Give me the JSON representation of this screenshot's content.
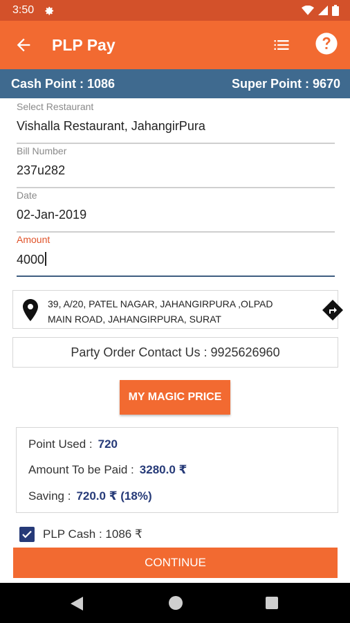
{
  "status_bar": {
    "time": "3:50",
    "settings_icon": "gear-icon",
    "wifi_icon": "wifi-icon",
    "signal_icon": "signal-icon",
    "battery_icon": "battery-icon"
  },
  "app_bar": {
    "title": "PLP Pay",
    "back_icon": "arrow-left-icon",
    "list_icon": "list-icon",
    "help_icon": "help-circle-icon",
    "color": "#f26a31"
  },
  "points": {
    "cash_label": "Cash Point : 1086",
    "super_label": "Super Point : 9670",
    "color": "#3f6a8f"
  },
  "form": {
    "restaurant": {
      "label": "Select Restaurant",
      "value": "Vishalla Restaurant, JahangirPura"
    },
    "bill": {
      "label": "Bill Number",
      "value": "237u282"
    },
    "date": {
      "label": "Date",
      "value": "02-Jan-2019"
    },
    "amount": {
      "label": "Amount",
      "value": "4000"
    }
  },
  "address": {
    "line1": "39, A/20, PATEL NAGAR, JAHANGIRPURA ,OLPAD",
    "line2": "MAIN ROAD, JAHANGIRPURA, SURAT",
    "pin_icon": "map-pin-icon",
    "directions_icon": "directions-icon"
  },
  "contact": {
    "text": "Party Order Contact Us :  9925626960"
  },
  "magic_button": {
    "label": "MY MAGIC PRICE"
  },
  "summary": {
    "points_used_label": "Point Used :",
    "points_used_value": "720",
    "amount_label": "Amount To be Paid :",
    "amount_value": "3280.0 ₹",
    "saving_label": "Saving :",
    "saving_value": "720.0 ₹ (18%)"
  },
  "plp_cash": {
    "label": "PLP Cash : 1086 ₹",
    "checked": true
  },
  "continue_button": {
    "label": "CONTINUE"
  },
  "nav_bar": {
    "back_icon": "nav-back-icon",
    "home_icon": "nav-home-icon",
    "recents_icon": "nav-recents-icon"
  }
}
